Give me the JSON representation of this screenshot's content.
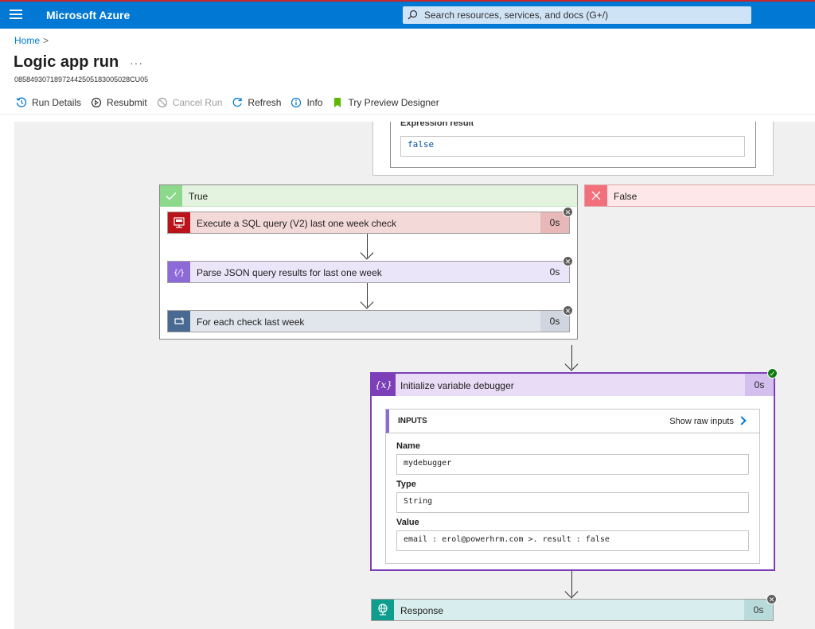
{
  "topbar": {
    "brand": "Microsoft Azure",
    "search_placeholder": "Search resources, services, and docs (G+/)"
  },
  "breadcrumb": {
    "home": "Home",
    "separator": ">"
  },
  "page": {
    "title": "Logic app run",
    "more": "···",
    "run_id": "08584930718972442505183005028CU05"
  },
  "toolbar": {
    "run_details": "Run Details",
    "resubmit": "Resubmit",
    "cancel_run": "Cancel Run",
    "refresh": "Refresh",
    "info": "Info",
    "preview": "Try Preview Designer"
  },
  "condition": {
    "expression_label": "Expression result",
    "expression_value": "false"
  },
  "branches": {
    "true_label": "True",
    "false_label": "False"
  },
  "actions": {
    "sql": {
      "label": "Execute a SQL query (V2) last one week check",
      "duration": "0s"
    },
    "parse": {
      "label": "Parse JSON query results for last one week",
      "duration": "0s"
    },
    "foreach": {
      "label": "For each check last week",
      "duration": "0s"
    }
  },
  "init_variable": {
    "label": "Initialize variable debugger",
    "duration": "0s",
    "icon_text": "{x}",
    "inputs_title": "INPUTS",
    "show_raw": "Show raw inputs",
    "name_label": "Name",
    "name_value": "mydebugger",
    "type_label": "Type",
    "type_value": "String",
    "value_label": "Value",
    "value_value": "email : erol@powerhrm.com >. result : false"
  },
  "response": {
    "label": "Response",
    "duration": "0s"
  },
  "colors": {
    "azure_blue": "#0078d4",
    "true_green": "#8cd98c",
    "false_red": "#f1707b",
    "sql_red": "#ba141a",
    "parse_purple": "#8c6ad8",
    "foreach_slate": "#486991",
    "init_purple": "#7c3fb8",
    "response_teal": "#0f9e8e"
  }
}
